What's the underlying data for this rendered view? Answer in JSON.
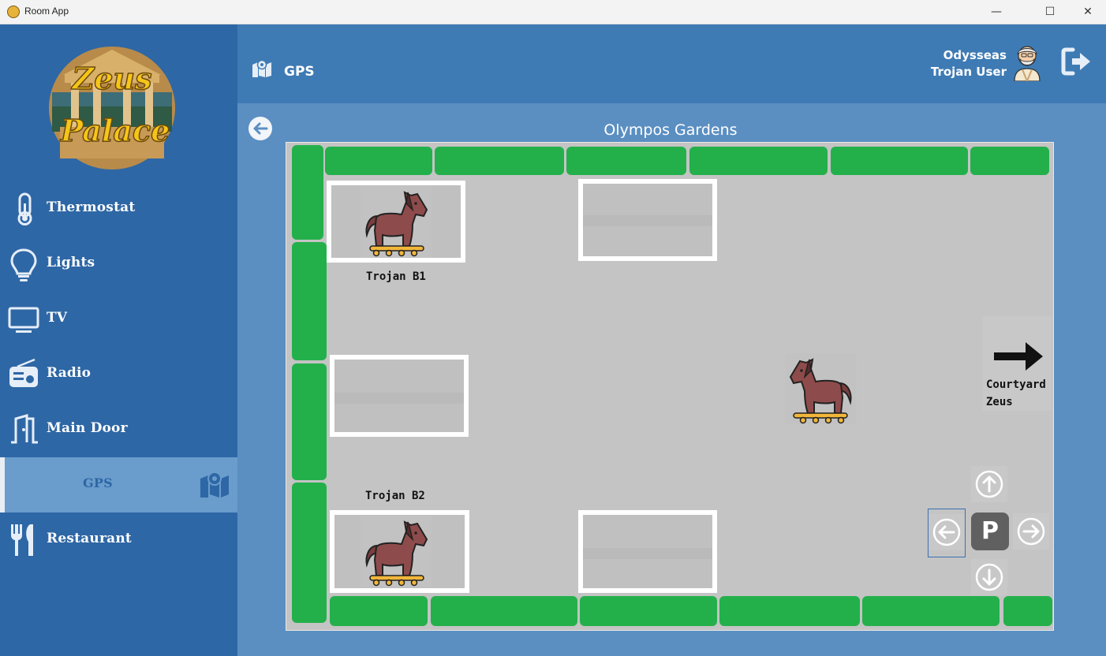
{
  "window": {
    "title": "Room App",
    "minimize": "—",
    "maximize": "☐",
    "close": "✕"
  },
  "sidebar": {
    "logo_text_line1": "Zeus",
    "logo_text_line2": "Palace",
    "items": [
      {
        "label": "Thermostat",
        "icon": "thermometer-icon"
      },
      {
        "label": "Lights",
        "icon": "lightbulb-icon"
      },
      {
        "label": "TV",
        "icon": "tv-icon"
      },
      {
        "label": "Radio",
        "icon": "radio-icon"
      },
      {
        "label": "Main Door",
        "icon": "door-icon"
      },
      {
        "label": "GPS",
        "icon": "map-icon",
        "active": true
      },
      {
        "label": "Restaurant",
        "icon": "cutlery-icon"
      }
    ]
  },
  "header": {
    "title": "GPS",
    "user_name": "Odysseas",
    "user_role": "Trojan User"
  },
  "map": {
    "title": "Olympos Gardens",
    "spots": [
      {
        "label": "Trojan B1",
        "occupied": true
      },
      {
        "label": "",
        "occupied": false
      },
      {
        "label": "",
        "occupied": false
      },
      {
        "label": "Trojan B2",
        "occupied": true
      },
      {
        "label": "",
        "occupied": false
      }
    ],
    "exit_line1": "Courtyard",
    "exit_line2": "Zeus",
    "park_label": "P"
  },
  "colors": {
    "sidebar": "#2e67a5",
    "header": "#3e7bb4",
    "content": "#5b8fc2",
    "hedge": "#23b04b",
    "horse": "#8e4b4b"
  }
}
